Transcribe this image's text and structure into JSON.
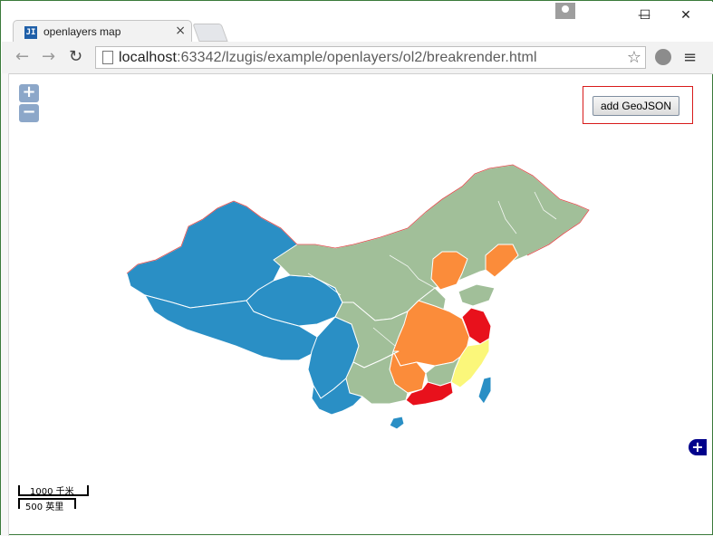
{
  "browser": {
    "tab": {
      "title": "openlayers map",
      "favicon": "JI",
      "close": "×"
    },
    "url": {
      "host": "localhost",
      "path": ":63342/lzugis/example/openlayers/ol2/breakrender.html"
    },
    "controls": {
      "back": "←",
      "forward": "→",
      "reload": "↻",
      "star": "☆",
      "menu": "≡",
      "minimize": "—",
      "maximize": "☐",
      "close": "✕"
    }
  },
  "map": {
    "zoom_in": "+",
    "zoom_out": "−",
    "add_geojson": "add GeoJSON",
    "expand": "+",
    "scale": {
      "top_label": "1000 千米",
      "bottom_label": "500 英里"
    },
    "colors": {
      "blue": "#2a8fc5",
      "green": "#a1bf99",
      "orange": "#fb8c3a",
      "red": "#e8111c",
      "yellow": "#fbf77a",
      "border": "#d81b1b"
    }
  }
}
